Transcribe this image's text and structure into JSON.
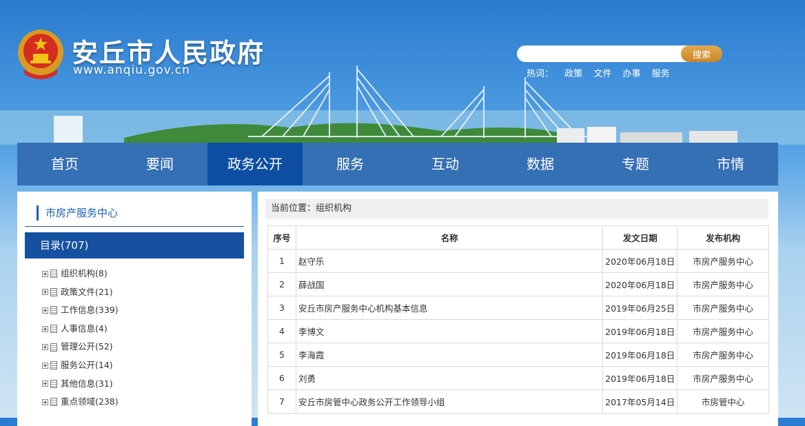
{
  "header": {
    "site_title": "安丘市人民政府",
    "site_url": "www.anqiu.gov.cn",
    "search": {
      "placeholder": "",
      "button": "搜索"
    },
    "hot": {
      "label": "热词：",
      "links": [
        "政策",
        "文件",
        "办事",
        "服务"
      ]
    }
  },
  "nav": {
    "items": [
      "首页",
      "要闻",
      "政务公开",
      "服务",
      "互动",
      "数据",
      "专题",
      "市情"
    ],
    "active_index": 2
  },
  "sidebar": {
    "title": "市房产服务中心",
    "catalog": "目录(707)",
    "items": [
      "组织机构(8)",
      "政策文件(21)",
      "工作信息(339)",
      "人事信息(4)",
      "管理公开(52)",
      "服务公开(14)",
      "其他信息(31)",
      "重点领域(238)"
    ]
  },
  "breadcrumb": "当前位置：组织机构",
  "table": {
    "headers": [
      "序号",
      "名称",
      "发文日期",
      "发布机构"
    ],
    "rows": [
      [
        "1",
        "赵守乐",
        "2020年06月18日",
        "市房产服务中心"
      ],
      [
        "2",
        "薛战国",
        "2020年06月18日",
        "市房产服务中心"
      ],
      [
        "3",
        "安丘市房产服务中心机构基本信息",
        "2019年06月25日",
        "市房产服务中心"
      ],
      [
        "4",
        "李博文",
        "2019年06月18日",
        "市房产服务中心"
      ],
      [
        "5",
        "李海霞",
        "2019年06月18日",
        "市房产服务中心"
      ],
      [
        "6",
        "刘勇",
        "2019年06月18日",
        "市房产服务中心"
      ],
      [
        "7",
        "安丘市房管中心政务公开工作领导小组",
        "2017年05月14日",
        "市房管中心"
      ]
    ]
  },
  "colors": {
    "nav_bg": "#356fb4",
    "nav_active": "#0d4ea3",
    "accent": "#1b5fae",
    "search_button": "#d08f33"
  }
}
